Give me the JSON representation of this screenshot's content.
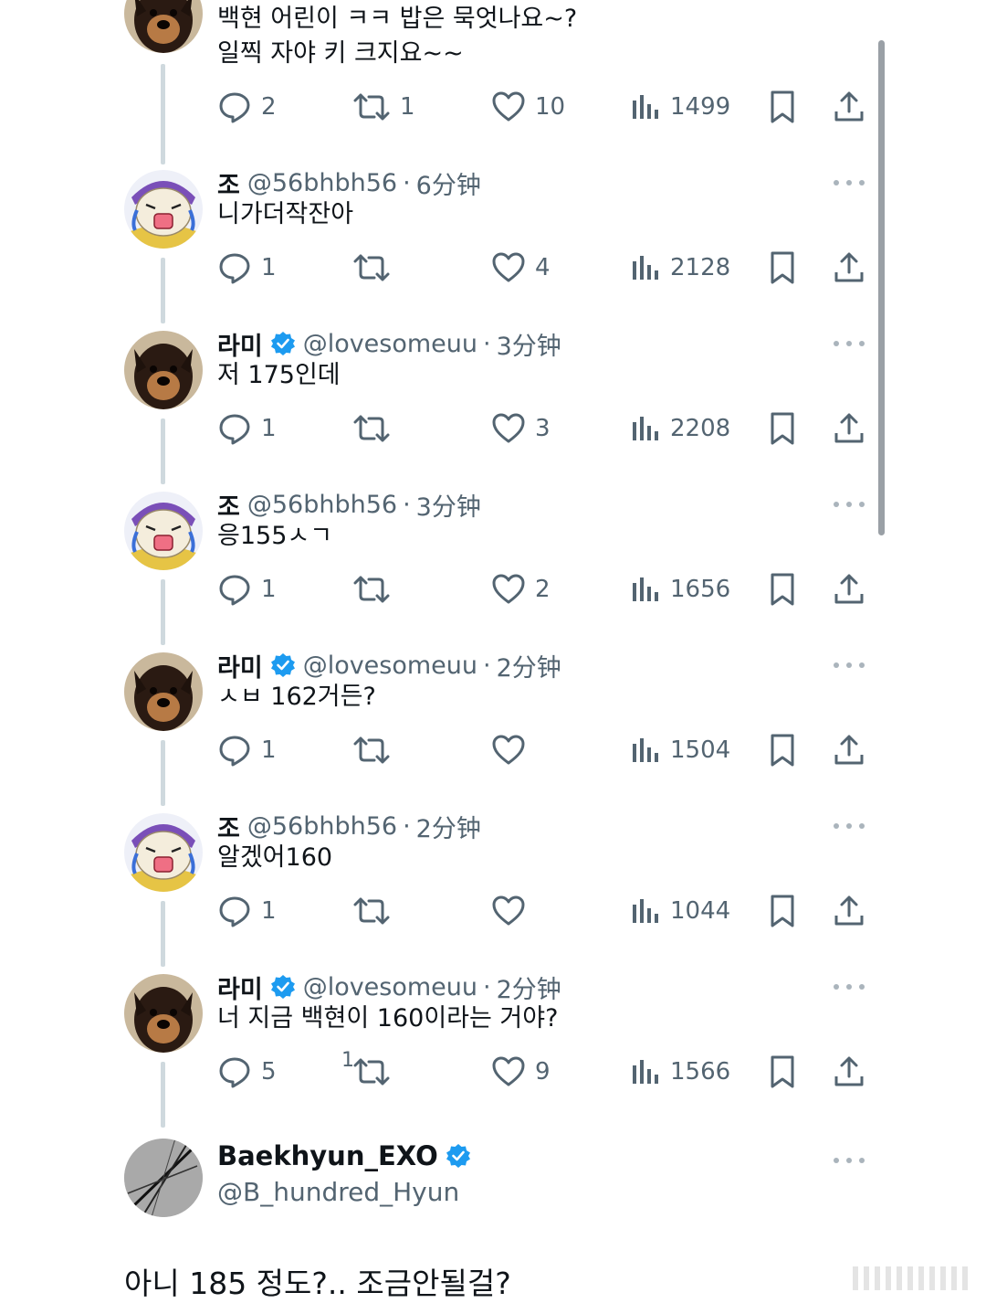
{
  "replies": [
    {
      "name": "",
      "handle": "",
      "time": "",
      "text_line1": "백현 어린이 ㅋㅋ 밥은 묵엇나요~?",
      "text_line2": "일찍 자야 키 크지요~~",
      "avatar": "dog",
      "verified": false,
      "stats": {
        "replies": "2",
        "retweets": "1",
        "likes": "10",
        "views": "1499"
      }
    },
    {
      "name": "조",
      "handle": "@56bhbh56",
      "time": "6分钟",
      "text_line1": "니가더작잔아",
      "text_line2": "",
      "avatar": "cartoon",
      "verified": false,
      "stats": {
        "replies": "1",
        "retweets": "",
        "likes": "4",
        "views": "2128"
      }
    },
    {
      "name": "라미",
      "handle": "@lovesomeuu",
      "time": "3分钟",
      "text_line1": "저 175인데",
      "text_line2": "",
      "avatar": "dog",
      "verified": true,
      "stats": {
        "replies": "1",
        "retweets": "",
        "likes": "3",
        "views": "2208"
      }
    },
    {
      "name": "조",
      "handle": "@56bhbh56",
      "time": "3分钟",
      "text_line1": "응155ㅅㄱ",
      "text_line2": "",
      "avatar": "cartoon",
      "verified": false,
      "stats": {
        "replies": "1",
        "retweets": "",
        "likes": "2",
        "views": "1656"
      }
    },
    {
      "name": "라미",
      "handle": "@lovesomeuu",
      "time": "2分钟",
      "text_line1": "ㅅㅂ 162거든?",
      "text_line2": "",
      "avatar": "dog",
      "verified": true,
      "stats": {
        "replies": "1",
        "retweets": "",
        "likes": "",
        "views": "1504"
      }
    },
    {
      "name": "조",
      "handle": "@56bhbh56",
      "time": "2分钟",
      "text_line1": "알겠어160",
      "text_line2": "",
      "avatar": "cartoon",
      "verified": false,
      "stats": {
        "replies": "1",
        "retweets": "",
        "likes": "",
        "views": "1044"
      }
    },
    {
      "name": "라미",
      "handle": "@lovesomeuu",
      "time": "2分钟",
      "text_line1": "너 지금 백현이 160이라는 거야?",
      "text_line2": "",
      "avatar": "dog",
      "verified": true,
      "retweet_superscript": "1",
      "stats": {
        "replies": "5",
        "retweets": "",
        "likes": "9",
        "views": "1566"
      }
    }
  ],
  "main_tweet": {
    "name": "Baekhyun_EXO",
    "handle": "@B_hundred_Hyun",
    "verified": true,
    "text": "아니 185 정도?.. 조금안될걸?"
  },
  "separator_dot": "·",
  "colors": {
    "text": "#0f1419",
    "secondary": "#536471",
    "verified": "#1d9bf0",
    "thread_line": "#cfd9de"
  },
  "icons": {
    "reply": "speech-bubble-icon",
    "retweet": "retweet-arrows-icon",
    "like": "heart-icon",
    "views": "bar-chart-icon",
    "bookmark": "bookmark-icon",
    "share": "share-upload-icon",
    "more": "more-dots-icon",
    "verified": "verified-badge-icon"
  }
}
